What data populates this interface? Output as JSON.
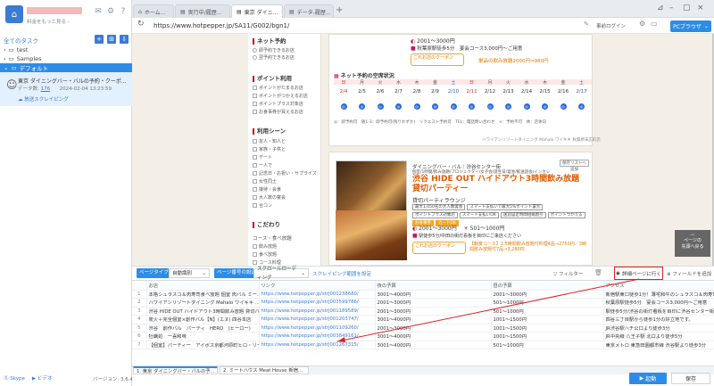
{
  "app": {
    "plan_label": "料金をもっと見る ›",
    "all_tasks": "全てのタスク",
    "version": "バージョン: 3.6.4"
  },
  "tree": {
    "test": "test",
    "samples": "Samples",
    "default": "デフォルト"
  },
  "task": {
    "name": "東京 ダイニングバー・バルの予約・クーポ...",
    "meta_label": "データ数:",
    "meta_count": "176",
    "meta_date": "2024-02-04 13:23:59",
    "scrape": "放送スクレイピング"
  },
  "footer": {
    "skype": "Skype",
    "video": "ビデオ"
  },
  "tabs": [
    {
      "label": "ホーム..."
    },
    {
      "label": "実行中/履歴..."
    },
    {
      "label": "東京 ダイニ..."
    },
    {
      "label": "データ-履歴..."
    }
  ],
  "address": {
    "url": "https://www.hotpepper.jp/SA11/G002/bgn1/",
    "login": "事前ログイン",
    "pc_browser": "PCブラウザ"
  },
  "sidebar": {
    "net_title": "ネット予約",
    "net_opts": [
      "即予約できるお店",
      "翌予約できるお店"
    ],
    "point_title": "ポイント利用",
    "point_opts": [
      "ポイントがたまるお店",
      "ポイントがつかえるお店",
      "ポイントプラス対象店",
      "お食事券が買えるお店"
    ],
    "scene_title": "利用シーン",
    "scene_opts": [
      "友人・知人と",
      "家族・子供と",
      "デート",
      "一人で",
      "記念日・お祝い・サプライズ",
      "女性同士",
      "接待・会食",
      "大人数の宴会",
      "合コン"
    ],
    "kodawari_title": "こだわり",
    "course_label": "コース・食べ放題",
    "course_opts": [
      "飲み放題",
      "食べ放題",
      "コース料理"
    ]
  },
  "card1": {
    "price1": "2001～3000円",
    "budget_note": "秋葉原駅徒歩5分　宴会コース3,000円～ご用意",
    "coupon_label": "これお店のクーポン",
    "coupon_text": "単品の飲み放題2000円⇒980円",
    "cal_title": "ネット予約の空席状況",
    "days": [
      "日",
      "月",
      "火",
      "水",
      "木",
      "金",
      "土",
      "日",
      "月",
      "火",
      "水",
      "木",
      "金",
      "土"
    ],
    "dates": [
      "2/4",
      "2/5",
      "2/6",
      "2/7",
      "2/8",
      "2/9",
      "2/10",
      "2/11",
      "2/12",
      "2/13",
      "2/14",
      "2/15",
      "2/16",
      "2/17"
    ],
    "legend": "◎：即予約可　随1-3：即予約可(残りわずか)　リクエスト予約可　TEL：電話問い合わせ　×：予約不可　休：店休日",
    "footer": "ハワイアンリゾートダイニング Mahalo ワイキキ 秋葉原末広町店"
  },
  "card2": {
    "bookmark": "保存リストへ追加",
    "genre": "ダイニングバー・バル｜渋谷センター街",
    "sub": "個室/1時間/飲み放題/プロジェクター/女子会/誕生日/宴会/歓送迎会/インカレ",
    "title": "渋谷 HIDE OUT ハイドアウト3時間飲み放題 貸切パーティー",
    "sub_shop": "貸切パーティラウンジ",
    "tags": [
      "最大1,050名の大人数宴会",
      "スマート支払いで最大5%ポイント還元",
      "ポイントプラス対象店",
      "スマート支払いOK",
      "送迎設定時間短縮割引",
      "ポイントつかえる",
      "お食事券",
      "カードOK"
    ],
    "price_lunch": "2001～3000円",
    "price_dinner": "501～1000円",
    "access": "駅徒歩5分/中田の街灯看板を目印にご来店ください",
    "coupon_label": "これお店のクーポン",
    "coupon_text": "【鍋宴コース】2.5時間飲み放題付料理4品→2750円／3時間飲み放題付7品→3,280円"
  },
  "float_btn": {
    "line1": "ページの",
    "line2": "先頭へ戻る"
  },
  "toolbar": {
    "task_type_label": "ページタイプ",
    "task_type_value": "自動識別",
    "settings_label": "ページ番号の設定",
    "scroll_value": "スクロールローディング",
    "scroll_link": "スクレイピング範囲を設定",
    "filter": "フィルター",
    "detail": "詳細ページに行く",
    "add_field": "フィールドを追加"
  },
  "table": {
    "headers": [
      "",
      "お店",
      "リンク",
      "夜の予算",
      "昼の予算",
      "アクセス"
    ],
    "rows": [
      [
        "1",
        "本格シュラスコ＆肉寿司食べ放題 個室 肉バル ミー...",
        "https://www.hotpepper.jp/strJ001238680/",
        "3001～4000円",
        "2001～3000円",
        "新宿駅東口徒歩1分！薄宅和牛のシュラスコ＆肉寿司ツ..."
      ],
      [
        "2",
        "ハワイアンリゾートダイニング Mahalo ワイキキ ...",
        "https://www.hotpepper.jp/strJ003599786/",
        "2001～3000円",
        "501～1000円",
        "秋葉原駅徒歩5分　宴会コース3,000円～ご用意"
      ],
      [
        "3",
        "渋谷 HIDE OUT ハイドアウト3時間飲み放題 貸切パ...",
        "https://www.hotpepper.jp/strJ001189589/",
        "2001～3000円",
        "501～1000円",
        "駅徒歩5分/渋谷の街灯看板を目印に渋谷センター街..."
      ],
      [
        "4",
        "炭火＋完全個室×創作バル【N】(エヌ) 四谷本店",
        "https://www.hotpepper.jp/strJ001203747/",
        "3001～4000円",
        "1001～1500円",
        "四谷三丁目駅から徒歩1分の好立地です。"
      ],
      [
        "5",
        "渋谷　創作バル　パーティ　HERO　(ヒーロー)",
        "https://www.hotpepper.jp/strJ001109260/",
        "2001～3000円",
        "1001～1500円",
        "JR渋谷駅ハチ公口より徒歩3分"
      ],
      [
        "6",
        "牡蠣処　一喜和味",
        "https://www.hotpepper.jp/strJ003849161/",
        "3001～4000円",
        "1001～1500円",
        "JR中央線 八王子駅 北口より徒歩5分"
      ],
      [
        "7",
        "【個室】パーティー　アイボス京都河原町ヒロ・リー...",
        "https://www.hotpepper.jp/strJ001267315/",
        "3001～4000円",
        "501～1000円",
        "東京メトロ 東急田園都市線 渋谷駅より徒歩3分"
      ]
    ]
  },
  "bottom_tabs": [
    "1. 東京 ダイニングバー・バルの予...",
    "2. ミートハウス Meat House 新宿..."
  ],
  "bottom": {
    "start": "起動",
    "save": "保存"
  }
}
